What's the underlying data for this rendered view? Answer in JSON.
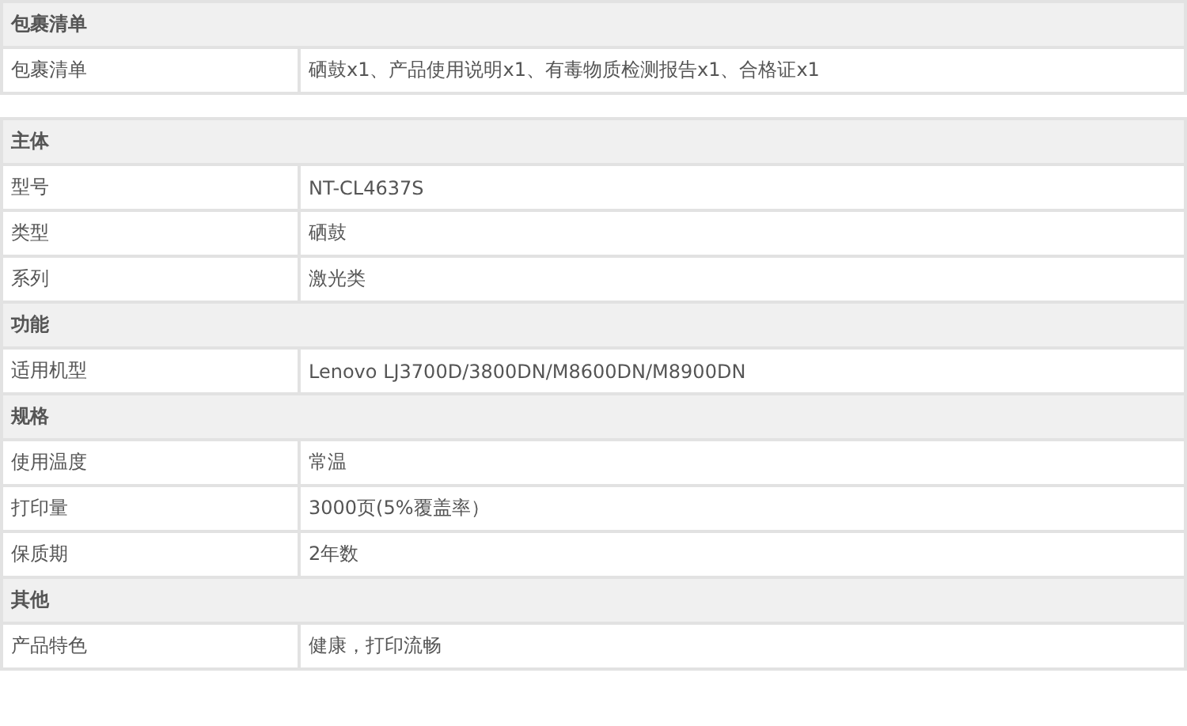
{
  "tables": [
    {
      "sections": [
        {
          "title": "包裹清单",
          "rows": [
            {
              "label": "包裹清单",
              "value": "硒鼓x1、产品使用说明x1、有毒物质检测报告x1、合格证x1"
            }
          ]
        }
      ]
    },
    {
      "sections": [
        {
          "title": "主体",
          "rows": [
            {
              "label": "型号",
              "value": "NT-CL4637S"
            },
            {
              "label": "类型",
              "value": "硒鼓"
            },
            {
              "label": "系列",
              "value": "激光类"
            }
          ]
        },
        {
          "title": "功能",
          "rows": [
            {
              "label": "适用机型",
              "value": "Lenovo LJ3700D/3800DN/M8600DN/M8900DN"
            }
          ]
        },
        {
          "title": "规格",
          "rows": [
            {
              "label": "使用温度",
              "value": "常温"
            },
            {
              "label": "打印量",
              "value": "3000页(5%覆盖率）"
            },
            {
              "label": "保质期",
              "value": "2年数"
            }
          ]
        },
        {
          "title": "其他",
          "rows": [
            {
              "label": "产品特色",
              "value": "健康，打印流畅"
            }
          ]
        }
      ]
    }
  ]
}
